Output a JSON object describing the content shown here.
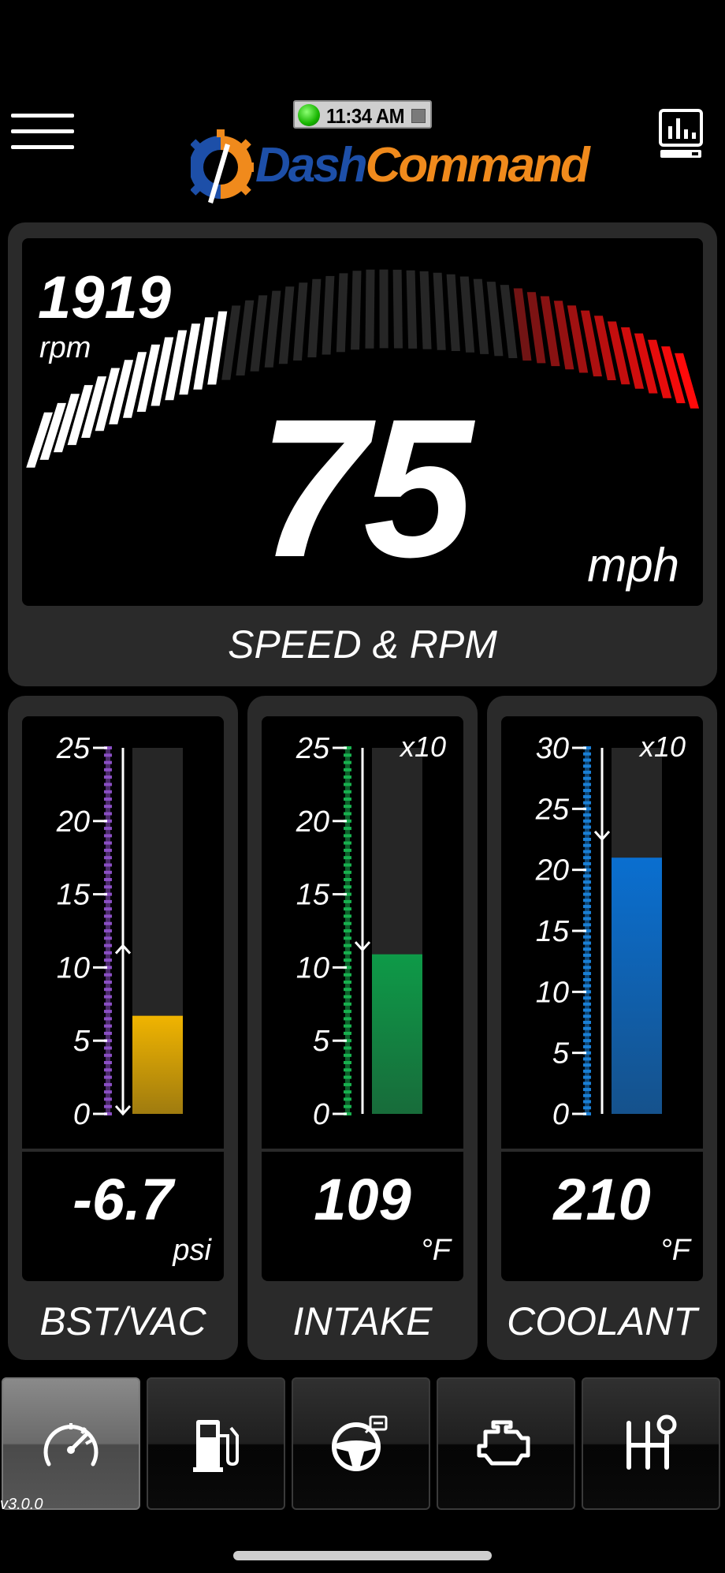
{
  "header": {
    "status_time": "11:34 AM",
    "logo": {
      "part1": "Dash",
      "part2": "Command"
    },
    "icons": {
      "menu": "hamburger-menu-icon",
      "monitor": "monitor-chart-icon"
    }
  },
  "speed_panel": {
    "rpm_value": "1919",
    "rpm_unit": "rpm",
    "speed_value": "75",
    "speed_unit": "mph",
    "title": "SPEED & RPM",
    "rpm_fraction": 0.29
  },
  "gauges": [
    {
      "id": "bst-vac",
      "label": "BST/VAC",
      "value": "-6.7",
      "unit": "psi",
      "ticks": [
        "25",
        "20",
        "15",
        "10",
        "5",
        "0"
      ],
      "multiplier": "",
      "scale_max": 25,
      "bar_level": 6.7,
      "marker_level": 11.5,
      "bar_color": "#f0b400",
      "scale_color": "#8a4fc4"
    },
    {
      "id": "intake",
      "label": "INTAKE",
      "value": "109",
      "unit": "°F",
      "ticks": [
        "25",
        "20",
        "15",
        "10",
        "5",
        "0"
      ],
      "multiplier": "x10",
      "scale_max": 25,
      "bar_level": 10.9,
      "marker_level": 11.2,
      "bar_color": "#0e9a48",
      "scale_color": "#18b04e"
    },
    {
      "id": "coolant",
      "label": "COOLANT",
      "value": "210",
      "unit": "°F",
      "ticks": [
        "30",
        "25",
        "20",
        "15",
        "10",
        "5",
        "0"
      ],
      "multiplier": "x10",
      "scale_max": 30,
      "bar_level": 21,
      "marker_level": 22.5,
      "bar_color": "#0a6fd0",
      "scale_color": "#1a7fd6"
    }
  ],
  "tabs": [
    {
      "name": "tab-dashboard",
      "icon": "speedometer-icon",
      "active": true
    },
    {
      "name": "tab-fuel",
      "icon": "fuel-pump-icon",
      "active": false
    },
    {
      "name": "tab-drive",
      "icon": "steering-wheel-icon",
      "active": false
    },
    {
      "name": "tab-diagnostics",
      "icon": "check-engine-icon",
      "active": false
    },
    {
      "name": "tab-gear",
      "icon": "gear-shifter-icon",
      "active": false
    }
  ],
  "version": "v3.0.0"
}
